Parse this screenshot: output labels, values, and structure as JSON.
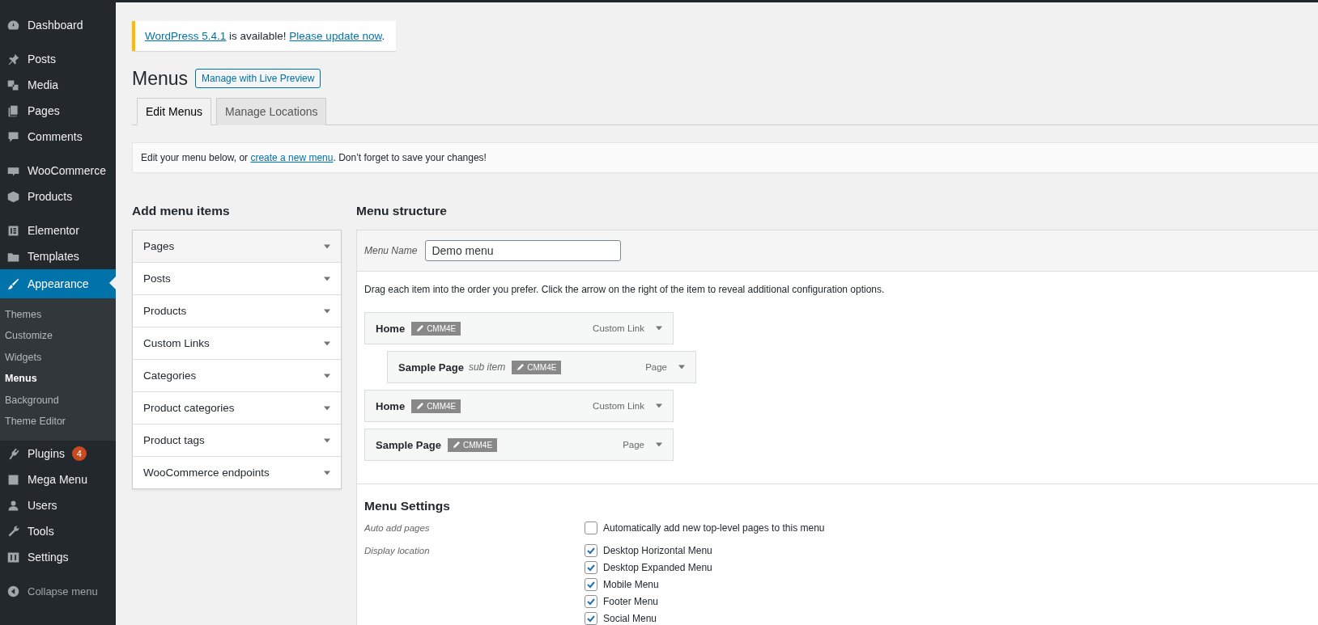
{
  "sidebar": {
    "groups": [
      [
        {
          "label": "Dashboard",
          "selected": false
        }
      ],
      [
        {
          "label": "Posts",
          "selected": false
        },
        {
          "label": "Media",
          "selected": false
        },
        {
          "label": "Pages",
          "selected": false
        },
        {
          "label": "Comments",
          "selected": false
        }
      ],
      [
        {
          "label": "WooCommerce",
          "selected": false
        },
        {
          "label": "Products",
          "selected": false
        }
      ],
      [
        {
          "label": "Elementor",
          "selected": false
        },
        {
          "label": "Templates",
          "selected": false
        },
        {
          "label": "Appearance",
          "selected": true,
          "children": [
            {
              "label": "Themes",
              "selected": false
            },
            {
              "label": "Customize",
              "selected": false
            },
            {
              "label": "Widgets",
              "selected": false
            },
            {
              "label": "Menus",
              "selected": true
            },
            {
              "label": "Background",
              "selected": false
            },
            {
              "label": "Theme Editor",
              "selected": false
            }
          ]
        },
        {
          "label": "Plugins",
          "selected": false,
          "badge": "4"
        },
        {
          "label": "Mega Menu",
          "selected": false
        },
        {
          "label": "Users",
          "selected": false
        },
        {
          "label": "Tools",
          "selected": false
        },
        {
          "label": "Settings",
          "selected": false
        }
      ]
    ],
    "collapse": "Collapse menu"
  },
  "notice": {
    "parts": [
      {
        "kind": "link",
        "text": "WordPress 5.4.1"
      },
      {
        "kind": "text",
        "text": " is available! "
      },
      {
        "kind": "link",
        "text": "Please update now"
      },
      {
        "kind": "text",
        "text": "."
      }
    ]
  },
  "title": "Menus",
  "live_preview_button": "Manage with Live Preview",
  "tabs": [
    {
      "label": "Edit Menus",
      "selected": true
    },
    {
      "label": "Manage Locations",
      "selected": false
    }
  ],
  "info": {
    "parts": [
      {
        "kind": "text",
        "text": "Edit your menu below, or "
      },
      {
        "kind": "link",
        "text": "create a new menu"
      },
      {
        "kind": "text",
        "text": ". Don’t forget to save your changes!"
      }
    ]
  },
  "add_items": {
    "heading": "Add menu items",
    "sections": [
      {
        "label": "Pages",
        "expanded": false
      },
      {
        "label": "Posts",
        "expanded": false
      },
      {
        "label": "Products",
        "expanded": false
      },
      {
        "label": "Custom Links",
        "expanded": false
      },
      {
        "label": "Categories",
        "expanded": false
      },
      {
        "label": "Product categories",
        "expanded": false
      },
      {
        "label": "Product tags",
        "expanded": false
      },
      {
        "label": "WooCommerce endpoints",
        "expanded": false
      }
    ]
  },
  "structure": {
    "heading": "Menu structure",
    "name_label": "Menu Name",
    "name_value": "Demo menu",
    "instructions": "Drag each item into the order you prefer. Click the arrow on the right of the item to reveal additional configuration options.",
    "items": [
      {
        "title": "Home",
        "badge": "CMM4E",
        "type": "Custom Link",
        "children": [
          {
            "title": "Sample Page",
            "note": "sub item",
            "badge": "CMM4E",
            "type": "Page"
          }
        ]
      },
      {
        "title": "Home",
        "badge": "CMM4E",
        "type": "Custom Link"
      },
      {
        "title": "Sample Page",
        "badge": "CMM4E",
        "type": "Page"
      }
    ]
  },
  "settings": {
    "heading": "Menu Settings",
    "rows": [
      {
        "label": "Auto add pages",
        "options": [
          {
            "label": "Automatically add new top-level pages to this menu",
            "checked": false
          }
        ]
      },
      {
        "label": "Display location",
        "options": [
          {
            "label": "Desktop Horizontal Menu",
            "checked": true
          },
          {
            "label": "Desktop Expanded Menu",
            "checked": true
          },
          {
            "label": "Mobile Menu",
            "checked": true
          },
          {
            "label": "Footer Menu",
            "checked": true
          },
          {
            "label": "Social Menu",
            "checked": true
          }
        ]
      }
    ]
  }
}
